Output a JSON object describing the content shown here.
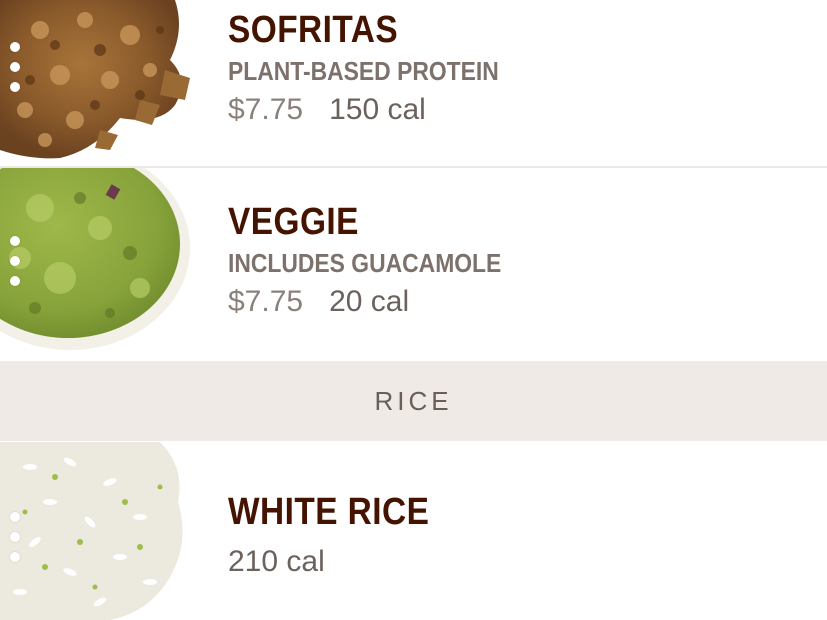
{
  "menu": {
    "items": [
      {
        "name": "SOFRITAS",
        "description": "PLANT-BASED PROTEIN",
        "price": "$7.75",
        "calories": "150 cal",
        "image_icon": "sofritas-image"
      },
      {
        "name": "VEGGIE",
        "description": "INCLUDES GUACAMOLE",
        "price": "$7.75",
        "calories": "20 cal",
        "image_icon": "guacamole-image"
      }
    ],
    "section": {
      "title": "RICE"
    },
    "rice_items": [
      {
        "name": "WHITE RICE",
        "calories": "210 cal",
        "image_icon": "white-rice-image"
      }
    ]
  },
  "colors": {
    "name_text": "#451400",
    "description_text": "#7d716b",
    "section_bg": "#efeae5"
  }
}
